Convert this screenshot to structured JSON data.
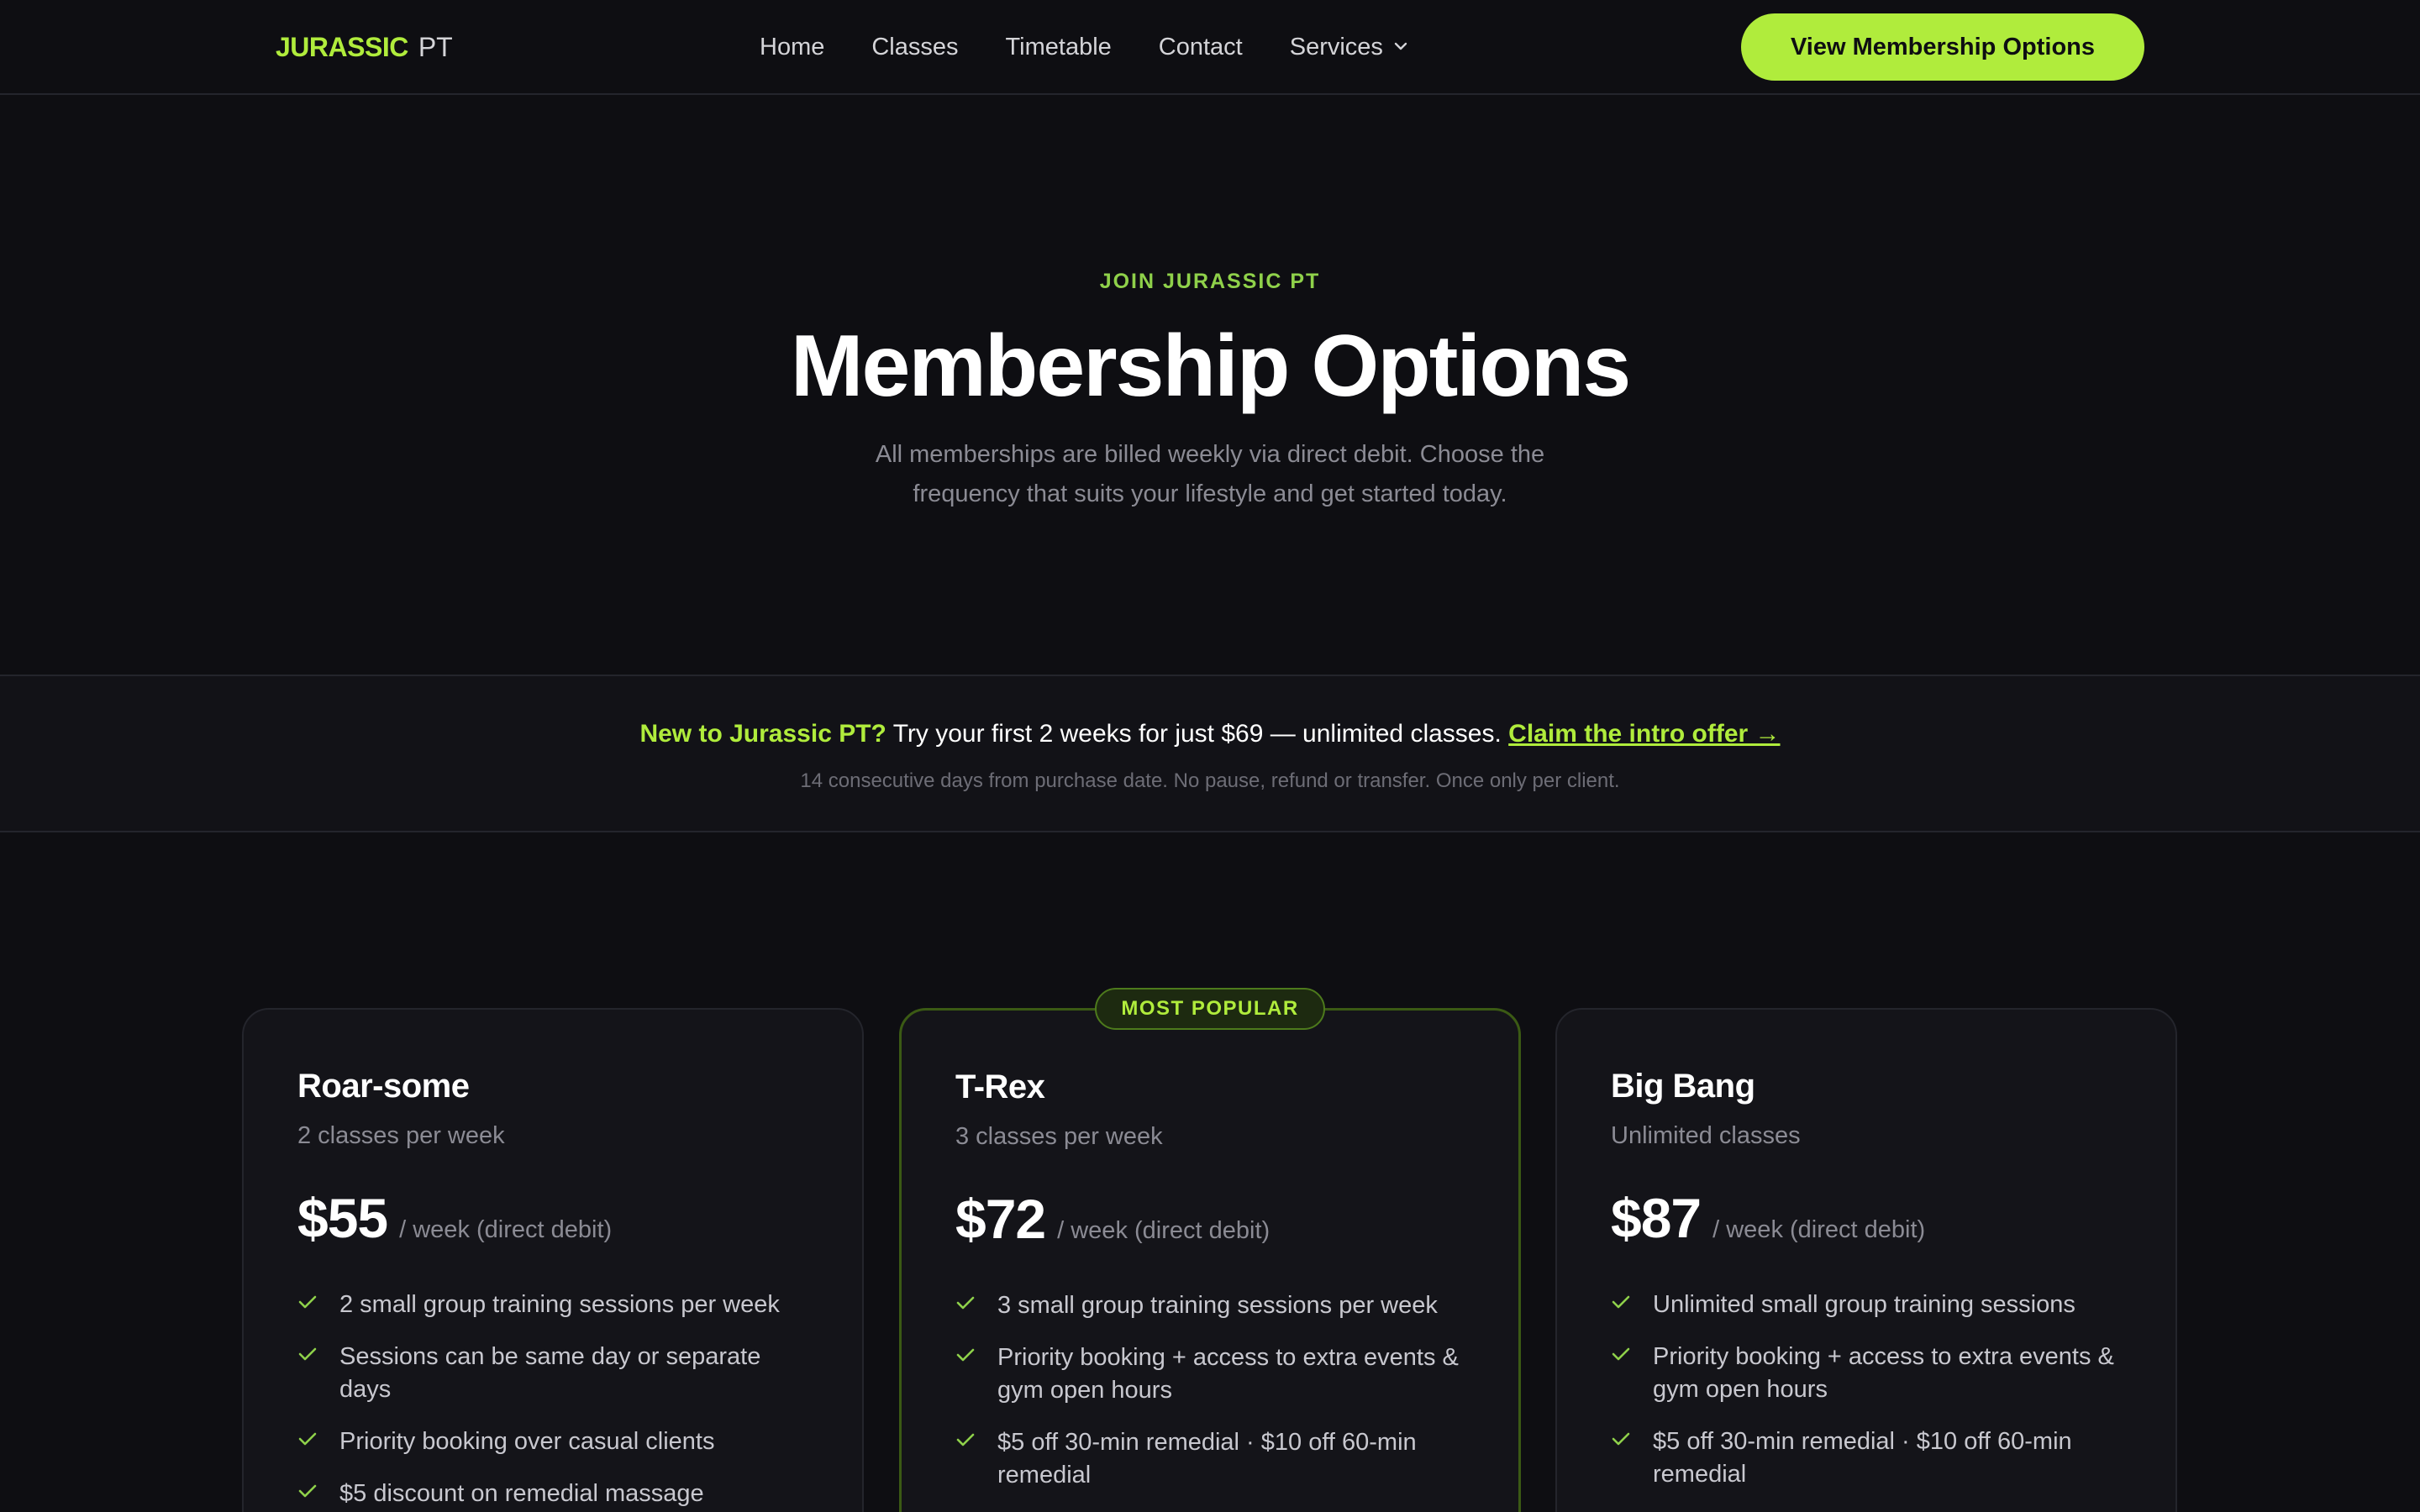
{
  "nav": {
    "logo_primary": "JURASSIC",
    "logo_secondary": "PT",
    "items": [
      "Home",
      "Classes",
      "Timetable",
      "Contact",
      "Services"
    ],
    "cta": "View Membership Options"
  },
  "hero": {
    "eyebrow": "JOIN JURASSIC PT",
    "title": "Membership Options",
    "subtitle": "All memberships are billed weekly via direct debit. Choose the frequency that suits your lifestyle and get started today."
  },
  "promo": {
    "highlight": "New to Jurassic PT?",
    "text": "Try your first 2 weeks for just $69 — unlimited classes.",
    "link": "Claim the intro offer →",
    "note": "14 consecutive days from purchase date. No pause, refund or transfer. Once only per client."
  },
  "plans": [
    {
      "name": "Roar-some",
      "subtitle": "2 classes per week",
      "price": "$55",
      "period": "/ week (direct debit)",
      "features": [
        "2 small group training sessions per week",
        "Sessions can be same day or separate days",
        "Priority booking over casual clients",
        "$5 discount on remedial massage"
      ]
    },
    {
      "name": "T-Rex",
      "badge": "MOST POPULAR",
      "subtitle": "3 classes per week",
      "price": "$72",
      "period": "/ week (direct debit)",
      "features": [
        "3 small group training sessions per week",
        "Priority booking + access to extra events & gym open hours",
        "$5 off 30-min remedial · $10 off 60-min remedial"
      ]
    },
    {
      "name": "Big Bang",
      "subtitle": "Unlimited classes",
      "price": "$87",
      "period": "/ week (direct debit)",
      "features": [
        "Unlimited small group training sessions",
        "Priority booking + access to extra events & gym open hours",
        "$5 off 30-min remedial · $10 off 60-min remedial"
      ]
    }
  ],
  "colors": {
    "accent": "#b0ec3c",
    "background": "#0e0e12",
    "card": "#141419"
  },
  "icons": {
    "services_dropdown": "chevron-down-icon",
    "feature": "check-icon"
  }
}
